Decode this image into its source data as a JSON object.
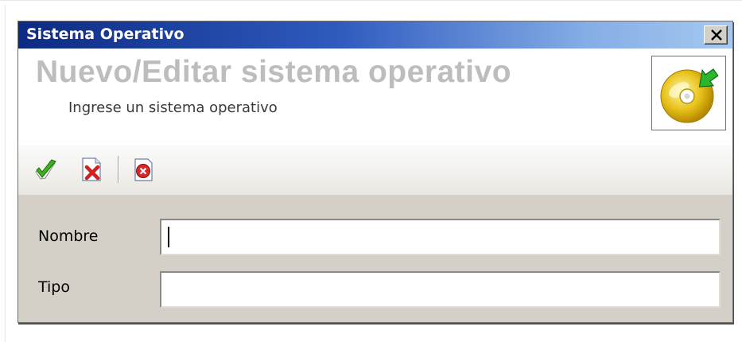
{
  "window": {
    "title": "Sistema Operativo",
    "close_label": "Close",
    "close_icon": "close-icon"
  },
  "header": {
    "title": "Nuevo/Editar sistema operativo",
    "subtitle": "Ingrese un sistema operativo",
    "icon": "cd-disc-icon"
  },
  "toolbar": {
    "items": [
      {
        "icon": "accept-icon"
      },
      {
        "icon": "cancel-doc-icon"
      },
      {
        "icon": "close-circle-icon"
      }
    ]
  },
  "form": {
    "nombre_label": "Nombre",
    "nombre_value": "",
    "tipo_label": "Tipo",
    "tipo_value": ""
  },
  "colors": {
    "title_gradient_start": "#0d2a82",
    "title_gradient_end": "#a6c8f0",
    "dialog_bg": "#d4d0c8",
    "header_title": "#bdbdbd"
  }
}
